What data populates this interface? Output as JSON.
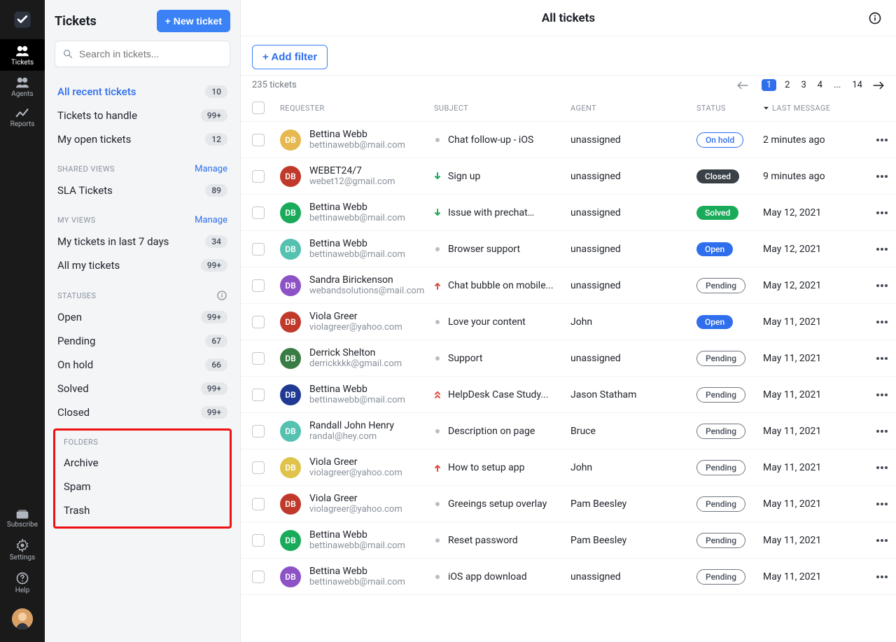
{
  "rail": {
    "items": [
      {
        "label": "Tickets"
      },
      {
        "label": "Agents"
      },
      {
        "label": "Reports"
      }
    ],
    "bottom": [
      {
        "label": "Subscribe"
      },
      {
        "label": "Settings"
      },
      {
        "label": "Help"
      }
    ]
  },
  "sidebar": {
    "title": "Tickets",
    "new_button": "+ New ticket",
    "search_placeholder": "Search in tickets...",
    "primary": [
      {
        "label": "All recent tickets",
        "count": "10",
        "active": true
      },
      {
        "label": "Tickets to handle",
        "count": "99+"
      },
      {
        "label": "My open tickets",
        "count": "12"
      }
    ],
    "shared_heading": "SHARED VIEWS",
    "manage": "Manage",
    "shared": [
      {
        "label": "SLA Tickets",
        "count": "89"
      }
    ],
    "myviews_heading": "MY VIEWS",
    "myviews": [
      {
        "label": "My tickets in last 7 days",
        "count": "34"
      },
      {
        "label": "All my tickets",
        "count": "99+"
      }
    ],
    "statuses_heading": "STATUSES",
    "statuses": [
      {
        "label": "Open",
        "count": "99+"
      },
      {
        "label": "Pending",
        "count": "67"
      },
      {
        "label": "On hold",
        "count": "66"
      },
      {
        "label": "Solved",
        "count": "99+"
      },
      {
        "label": "Closed",
        "count": "99+"
      }
    ],
    "folders_heading": "FOLDERS",
    "folders": [
      {
        "label": "Archive"
      },
      {
        "label": "Spam"
      },
      {
        "label": "Trash"
      }
    ]
  },
  "main": {
    "title": "All tickets",
    "add_filter": "+ Add filter",
    "count_text": "235 tickets",
    "columns": {
      "requester": "REQUESTER",
      "subject": "SUBJECT",
      "agent": "AGENT",
      "status": "STATUS",
      "last_message": "LAST MESSAGE"
    },
    "pages": [
      "1",
      "2",
      "3",
      "4",
      "...",
      "14"
    ],
    "rows": [
      {
        "initials": "DB",
        "color": "#e6b84f",
        "name": "Bettina Webb",
        "email": "bettinawebb@mail.com",
        "prio": "dot",
        "subject": "Chat follow-up - iOS",
        "agent": "unassigned",
        "status": "On hold",
        "status_class": "onhold",
        "when": "2 minutes ago"
      },
      {
        "initials": "DB",
        "color": "#c0392b",
        "name": "WEBET24/7",
        "email": "webet12@gmail.com",
        "prio": "down",
        "subject": "Sign up",
        "agent": "unassigned",
        "status": "Closed",
        "status_class": "closed",
        "when": "9 minutes ago"
      },
      {
        "initials": "DB",
        "color": "#1aab5a",
        "name": "Bettina Webb",
        "email": "bettinawebb@mail.com",
        "prio": "down",
        "subject": "Issue with prechat…",
        "agent": "unassigned",
        "status": "Solved",
        "status_class": "solved",
        "when": "May 12, 2021"
      },
      {
        "initials": "DB",
        "color": "#55c1b0",
        "name": "Bettina Webb",
        "email": "bettinawebb@mail.com",
        "prio": "dot",
        "subject": "Browser support",
        "agent": "unassigned",
        "status": "Open",
        "status_class": "open",
        "when": "May 12, 2021"
      },
      {
        "initials": "DB",
        "color": "#8c52c6",
        "name": "Sandra Birickenson",
        "email": "webandsolutions@mail.com",
        "prio": "up",
        "subject": "Chat bubble on mobile...",
        "agent": "unassigned",
        "status": "Pending",
        "status_class": "pending",
        "when": "May 12, 2021"
      },
      {
        "initials": "DB",
        "color": "#c0392b",
        "name": "Viola Greer",
        "email": "violagreer@yahoo.com",
        "prio": "dot",
        "subject": "Love your content",
        "agent": "John",
        "status": "Open",
        "status_class": "open",
        "when": "May 11, 2021"
      },
      {
        "initials": "DB",
        "color": "#3a7d44",
        "name": "Derrick Shelton",
        "email": "derrickkkk@gmail.com",
        "prio": "dot",
        "subject": "Support",
        "agent": "unassigned",
        "status": "Pending",
        "status_class": "pending",
        "when": "May 11, 2021"
      },
      {
        "initials": "DB",
        "color": "#1f3a93",
        "name": "Bettina Webb",
        "email": "bettinawebb@mail.com",
        "prio": "dblup",
        "subject": "HelpDesk Case Study...",
        "agent": "Jason Statham",
        "status": "Pending",
        "status_class": "pending",
        "when": "May 11, 2021"
      },
      {
        "initials": "DB",
        "color": "#55c1b0",
        "name": "Randall John Henry",
        "email": "randal@hey.com",
        "prio": "dot",
        "subject": "Description on page",
        "agent": "Bruce",
        "status": "Pending",
        "status_class": "pending",
        "when": "May 11, 2021"
      },
      {
        "initials": "DB",
        "color": "#e0c34b",
        "name": "Viola Greer",
        "email": "violagreer@yahoo.com",
        "prio": "up",
        "subject": "How to setup app",
        "agent": "John",
        "status": "Pending",
        "status_class": "pending",
        "when": "May 11, 2021"
      },
      {
        "initials": "DB",
        "color": "#c0392b",
        "name": "Viola Greer",
        "email": "violagreer@yahoo.com",
        "prio": "dot",
        "subject": "Greeings setup overlay",
        "agent": "Pam Beesley",
        "status": "Pending",
        "status_class": "pending",
        "when": "May 11, 2021"
      },
      {
        "initials": "DB",
        "color": "#1aab5a",
        "name": "Bettina Webb",
        "email": "bettinawebb@mail.com",
        "prio": "dot",
        "subject": "Reset password",
        "agent": "Pam Beesley",
        "status": "Pending",
        "status_class": "pending",
        "when": "May 11, 2021"
      },
      {
        "initials": "DB",
        "color": "#8c52c6",
        "name": "Bettina Webb",
        "email": "bettinawebb@mail.com",
        "prio": "dot",
        "subject": "iOS app download",
        "agent": "unassigned",
        "status": "Pending",
        "status_class": "pending",
        "when": "May 11, 2021"
      }
    ]
  }
}
